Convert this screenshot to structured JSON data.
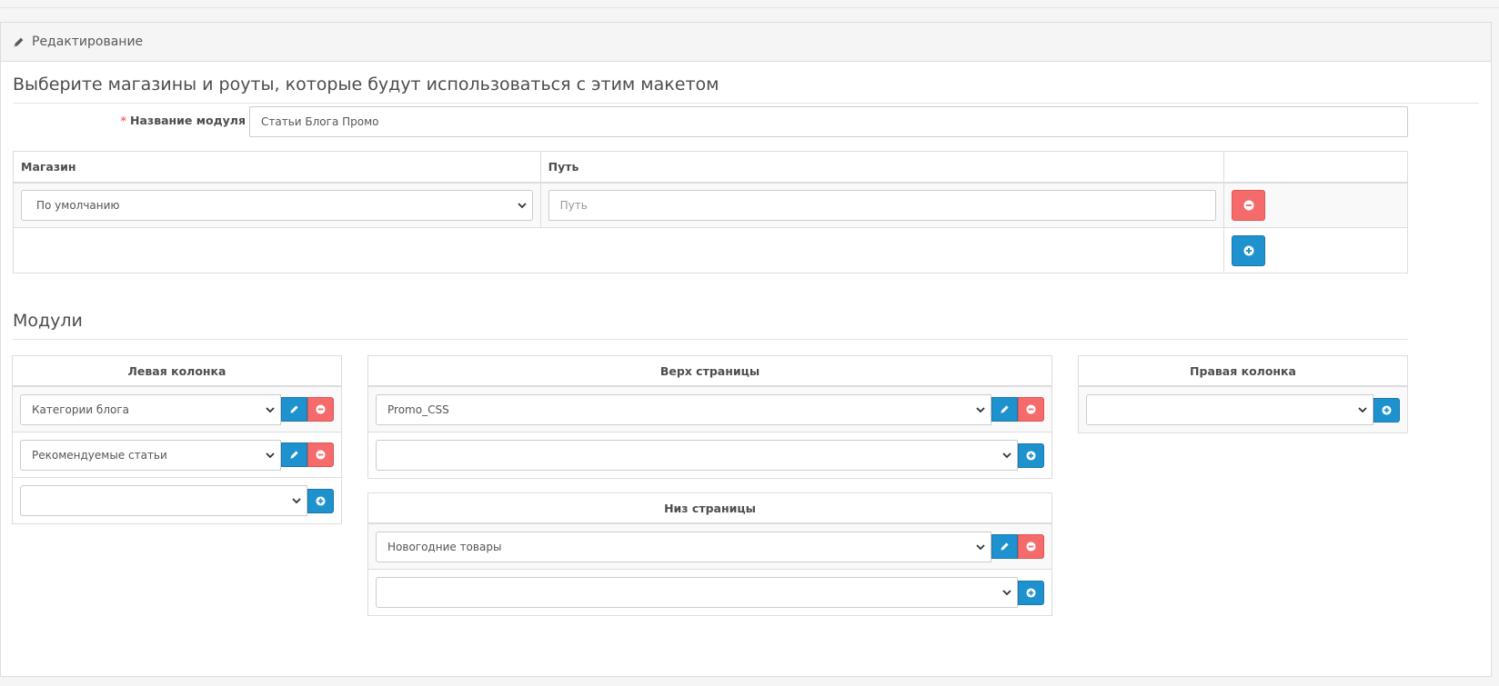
{
  "panel": {
    "heading": "Редактирование",
    "legend": "Выберите магазины и роуты, которые будут использоваться с этим макетом"
  },
  "form": {
    "name_label": "Название модуля",
    "required_mark": "*",
    "name_value": "Статьи Блога Промо"
  },
  "route_table": {
    "columns": [
      "Магазин",
      "Путь",
      ""
    ],
    "rows": [
      {
        "store": "По умолчанию",
        "path_placeholder": "Путь"
      }
    ]
  },
  "modules": {
    "title": "Модули",
    "left": {
      "header": "Левая колонка",
      "items": [
        "Категории блога",
        "Рекомендуемые статьи"
      ]
    },
    "top": {
      "header": "Верх страницы",
      "items": [
        "Promo_CSS"
      ]
    },
    "bottom": {
      "header": "Низ страницы",
      "items": [
        "Новогодние товары"
      ]
    },
    "right": {
      "header": "Правая колонка",
      "items": []
    }
  },
  "colors": {
    "danger": "#f56b6b",
    "primary": "#1e91cf"
  }
}
